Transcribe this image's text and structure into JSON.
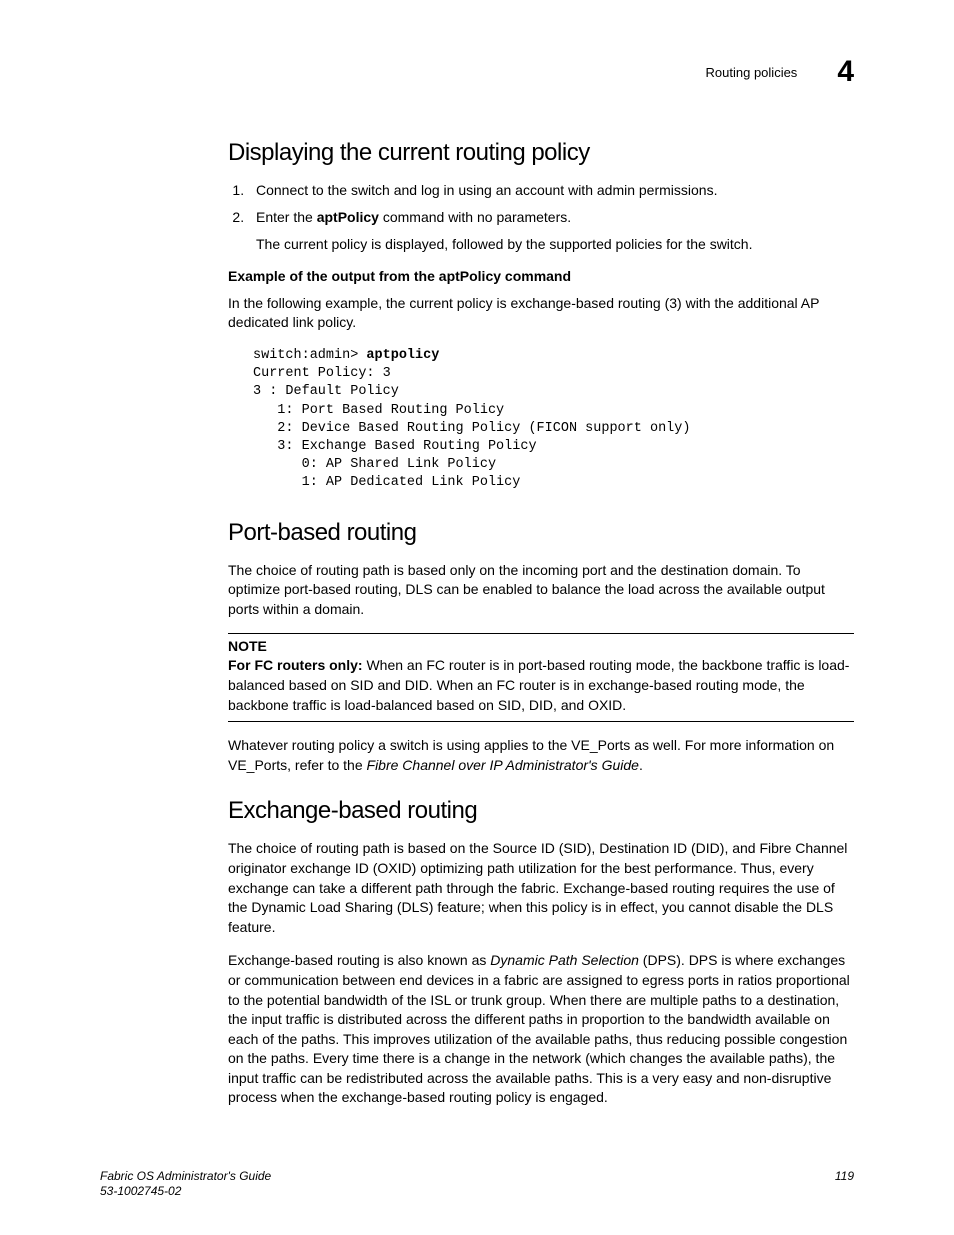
{
  "header": {
    "section": "Routing policies",
    "chapter": "4"
  },
  "h1": "Displaying the current routing policy",
  "steps": {
    "s1": "Connect to the switch and log in using an account with admin permissions.",
    "s2a": "Enter the ",
    "s2b": "aptPolicy",
    "s2c": " command with no parameters.",
    "s2sub": "The current policy is displayed, followed by the supported policies for the switch."
  },
  "exHead": "Example of the output from the aptPolicy command",
  "exIntro": "In the following example, the current policy is exchange-based routing (3) with the additional AP dedicated link policy.",
  "code": {
    "l1a": "switch:admin> ",
    "l1b": "aptpolicy",
    "l2": "Current Policy: 3",
    "l3": "3 : Default Policy",
    "l4": "   1: Port Based Routing Policy",
    "l5": "   2: Device Based Routing Policy (FICON support only)",
    "l6": "   3: Exchange Based Routing Policy",
    "l7": "      0: AP Shared Link Policy",
    "l8": "      1: AP Dedicated Link Policy"
  },
  "h2": "Port-based routing",
  "pbr_p1": "The choice of routing path is based only on the incoming port and the destination domain. To optimize port-based routing, DLS can be enabled to balance the load across the available output ports within a domain.",
  "note": {
    "title": "NOTE",
    "lead": "For FC routers only: ",
    "body": "When an FC router is in port-based routing mode, the backbone traffic is load-balanced based on SID and DID. When an FC router is in exchange-based routing mode, the backbone traffic is load-balanced based on SID, DID, and OXID."
  },
  "pbr_p2a": "Whatever routing policy a switch is using applies to the VE_Ports as well. For more information on VE_Ports, refer to the ",
  "pbr_p2b": "Fibre Channel over IP Administrator's Guide",
  "pbr_p2c": ".",
  "h3": "Exchange-based routing",
  "ebr_p1": "The choice of routing path is based on the Source ID (SID), Destination ID (DID), and Fibre Channel originator exchange ID (OXID) optimizing path utilization for the best performance. Thus, every exchange can take a different path through the fabric. Exchange-based routing requires the use of the Dynamic Load Sharing (DLS) feature; when this policy is in effect, you cannot disable the DLS feature.",
  "ebr_p2a": "Exchange-based routing is also known as ",
  "ebr_p2b": "Dynamic Path Selection",
  "ebr_p2c": " (DPS). DPS is where exchanges or communication between end devices in a fabric are assigned to egress ports in ratios proportional to the potential bandwidth of the ISL or trunk group. When there are multiple paths to a destination, the input traffic is distributed across the different paths in proportion to the bandwidth available on each of the paths. This improves utilization of the available paths, thus reducing possible congestion on the paths. Every time there is a change in the network (which changes the available paths), the input traffic can be redistributed across the available paths. This is a very easy and non-disruptive process when the exchange-based routing policy is engaged.",
  "footer": {
    "title": "Fabric OS Administrator's Guide",
    "docnum": "53-1002745-02",
    "page": "119"
  }
}
